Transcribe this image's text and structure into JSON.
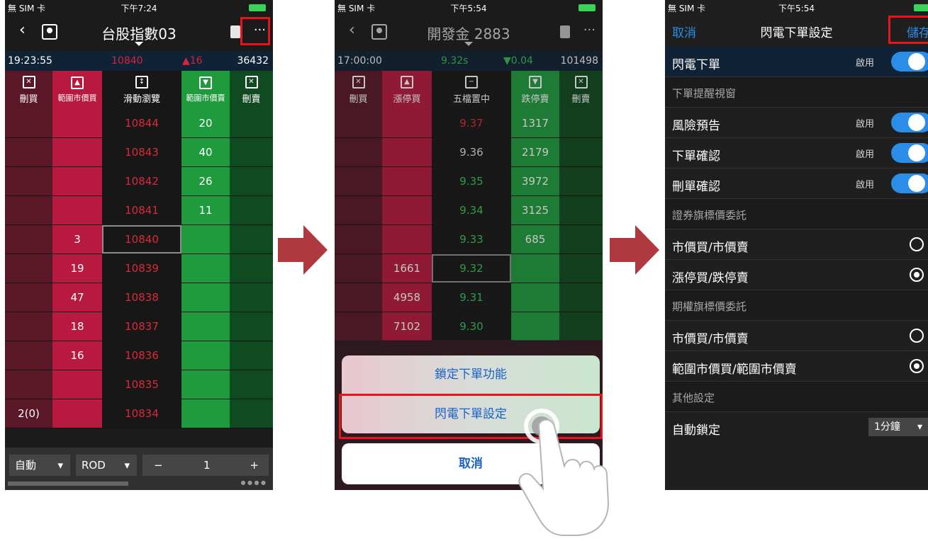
{
  "screen1": {
    "status": {
      "carrier": "無 SIM 卡",
      "time": "下午7:24"
    },
    "title": "台股指數03",
    "quote": {
      "time": "19:23:55",
      "price": "10840",
      "change": "▲16",
      "volume": "36432"
    },
    "headers": [
      "刪買",
      "範圍市價買",
      "滑動瀏覽",
      "範圍市價賣",
      "刪賣"
    ],
    "rows": [
      {
        "dbuy": "",
        "buy": "",
        "price": "10844",
        "sell": "20",
        "dsell": ""
      },
      {
        "dbuy": "",
        "buy": "",
        "price": "10843",
        "sell": "40",
        "dsell": ""
      },
      {
        "dbuy": "",
        "buy": "",
        "price": "10842",
        "sell": "26",
        "dsell": ""
      },
      {
        "dbuy": "",
        "buy": "",
        "price": "10841",
        "sell": "11",
        "dsell": ""
      },
      {
        "dbuy": "",
        "buy": "3",
        "price": "10840",
        "sell": "",
        "dsell": ""
      },
      {
        "dbuy": "",
        "buy": "19",
        "price": "10839",
        "sell": "",
        "dsell": ""
      },
      {
        "dbuy": "",
        "buy": "47",
        "price": "10838",
        "sell": "",
        "dsell": ""
      },
      {
        "dbuy": "",
        "buy": "18",
        "price": "10837",
        "sell": "",
        "dsell": ""
      },
      {
        "dbuy": "",
        "buy": "16",
        "price": "10836",
        "sell": "",
        "dsell": ""
      },
      {
        "dbuy": "",
        "buy": "",
        "price": "10835",
        "sell": "",
        "dsell": ""
      },
      {
        "dbuy": "2(0)",
        "buy": "",
        "price": "10834",
        "sell": "",
        "dsell": ""
      }
    ],
    "bottom": {
      "mode": "自動",
      "type": "ROD",
      "minus": "−",
      "qty": "1",
      "plus": "+"
    }
  },
  "screen2": {
    "status": {
      "carrier": "無 SIM 卡",
      "time": "下午5:54"
    },
    "title": "開發金 2883",
    "quote": {
      "time": "17:00:00",
      "price": "9.32s",
      "change": "▼0.04",
      "volume": "101498"
    },
    "headers": [
      "刪買",
      "漲停買",
      "五檔置中",
      "跌停賣",
      "刪賣"
    ],
    "rows": [
      {
        "buy": "",
        "price": "9.37",
        "sell": "1317"
      },
      {
        "buy": "",
        "price": "9.36",
        "sell": "2179"
      },
      {
        "buy": "",
        "price": "9.35",
        "sell": "3972"
      },
      {
        "buy": "",
        "price": "9.34",
        "sell": "3125"
      },
      {
        "buy": "",
        "price": "9.33",
        "sell": "685"
      },
      {
        "buy": "1661",
        "price": "9.32",
        "sell": ""
      },
      {
        "buy": "4958",
        "price": "9.31",
        "sell": ""
      },
      {
        "buy": "7102",
        "price": "9.30",
        "sell": ""
      }
    ],
    "sheet": {
      "lock": "鎖定下單功能",
      "settings": "閃電下單設定",
      "cancel": "取消"
    }
  },
  "screen3": {
    "status": {
      "carrier": "無 SIM 卡",
      "time": "下午5:54"
    },
    "nav": {
      "cancel": "取消",
      "title": "閃電下單設定",
      "save": "儲存"
    },
    "flash_order": {
      "label": "閃電下單",
      "state": "啟用"
    },
    "section_reminder": "下單提醒視窗",
    "risk": {
      "label": "風險預告",
      "state": "啟用"
    },
    "confirm": {
      "label": "下單確認",
      "state": "啟用"
    },
    "delete_confirm": {
      "label": "刪單確認",
      "state": "啟用"
    },
    "section_stock": "證券旗標價委託",
    "stock_opt1": "市價買/市價賣",
    "stock_opt2": "漲停買/跌停賣",
    "section_option": "期權旗標價委託",
    "option_opt1": "市價買/市價賣",
    "option_opt2": "範圍市價買/範圍市價賣",
    "section_other": "其他設定",
    "auto_lock": {
      "label": "自動鎖定",
      "value": "1分鐘"
    }
  }
}
